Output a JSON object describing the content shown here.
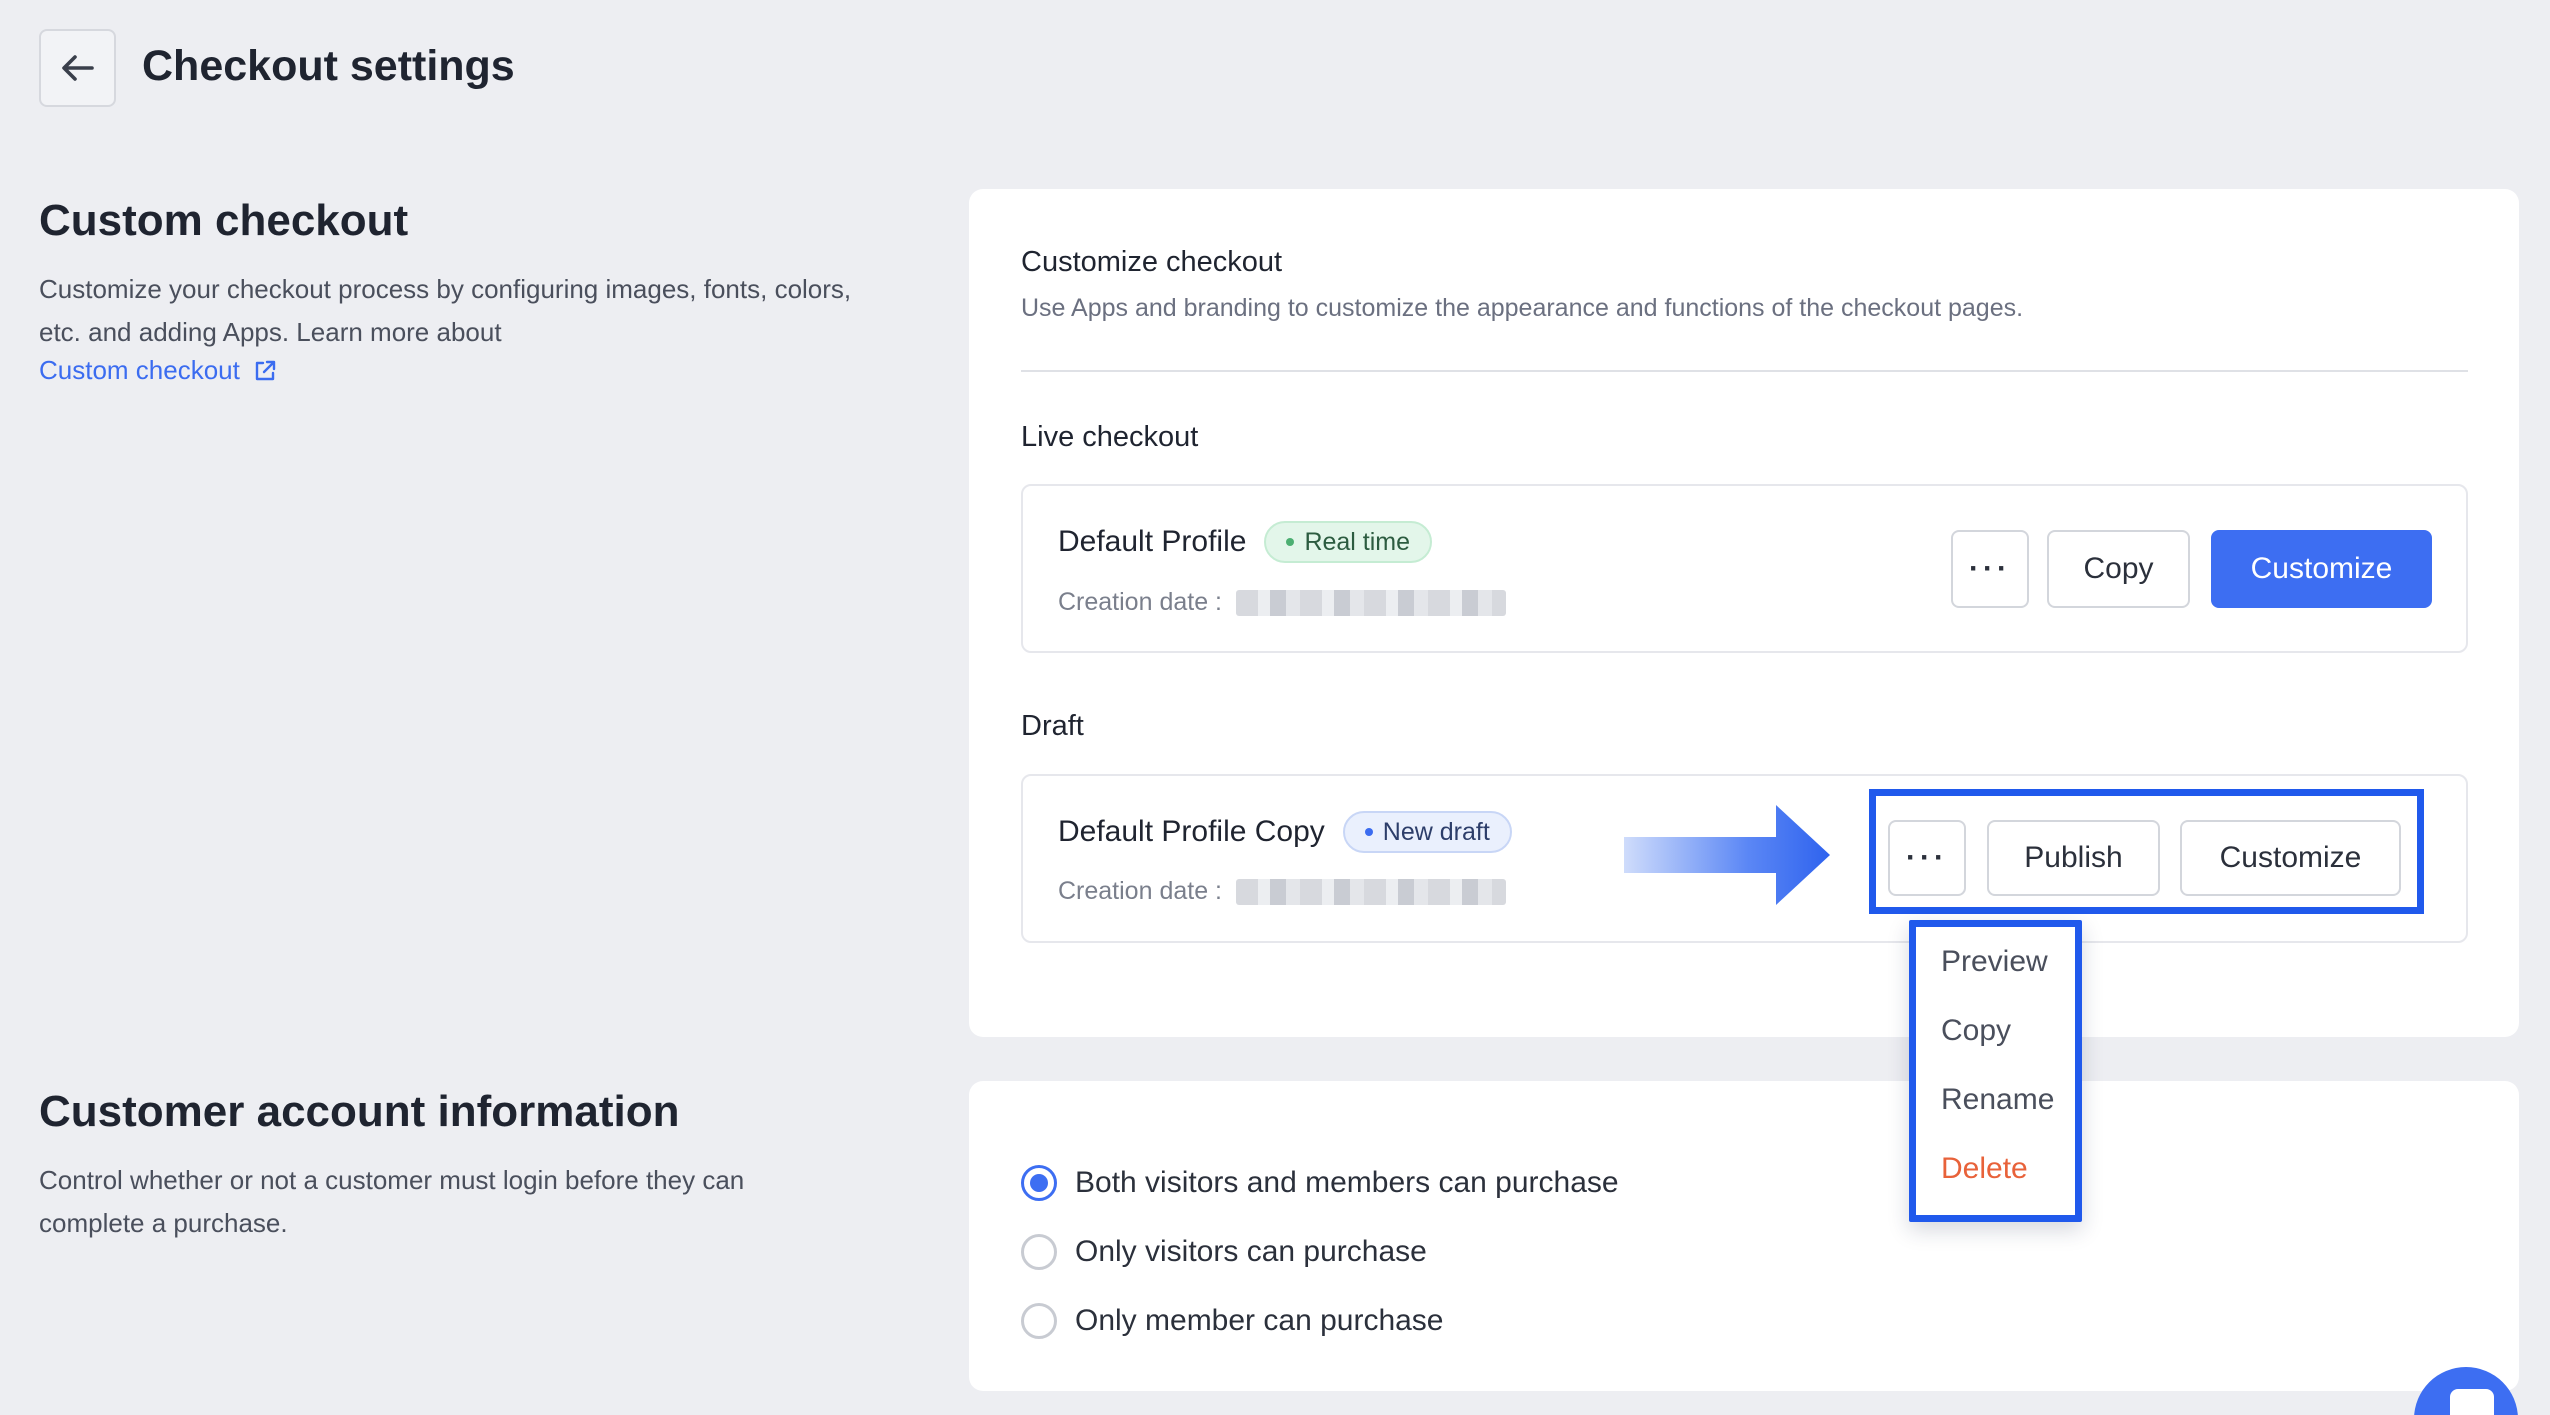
{
  "header": {
    "title": "Checkout settings"
  },
  "custom_checkout_section": {
    "title": "Custom checkout",
    "description": "Customize your checkout process by configuring images, fonts, colors, etc. and adding Apps. Learn more about",
    "link_label": "Custom checkout"
  },
  "customize_card": {
    "heading": "Customize checkout",
    "subheading": "Use Apps and branding to customize the appearance and functions of the checkout pages.",
    "live": {
      "label": "Live checkout",
      "profile_name": "Default Profile",
      "badge": "Real time",
      "created_label": "Creation date :",
      "more_label": "···",
      "copy_label": "Copy",
      "customize_label": "Customize"
    },
    "draft": {
      "label": "Draft",
      "profile_name": "Default Profile Copy",
      "badge": "New draft",
      "created_label": "Creation date :",
      "more_label": "···",
      "publish_label": "Publish",
      "customize_label": "Customize"
    },
    "menu": [
      "Preview",
      "Copy",
      "Rename",
      "Delete"
    ]
  },
  "account_section": {
    "title": "Customer account information",
    "description": "Control whether or not a customer must login before they can complete a purchase.",
    "options": [
      {
        "label": "Both visitors and members can purchase",
        "selected": true
      },
      {
        "label": "Only visitors can purchase",
        "selected": false
      },
      {
        "label": "Only member can purchase",
        "selected": false
      }
    ]
  },
  "colors": {
    "accent": "#3d6ef2",
    "highlight": "#2059ec",
    "danger": "#e8623a",
    "success": "#4caf72"
  }
}
